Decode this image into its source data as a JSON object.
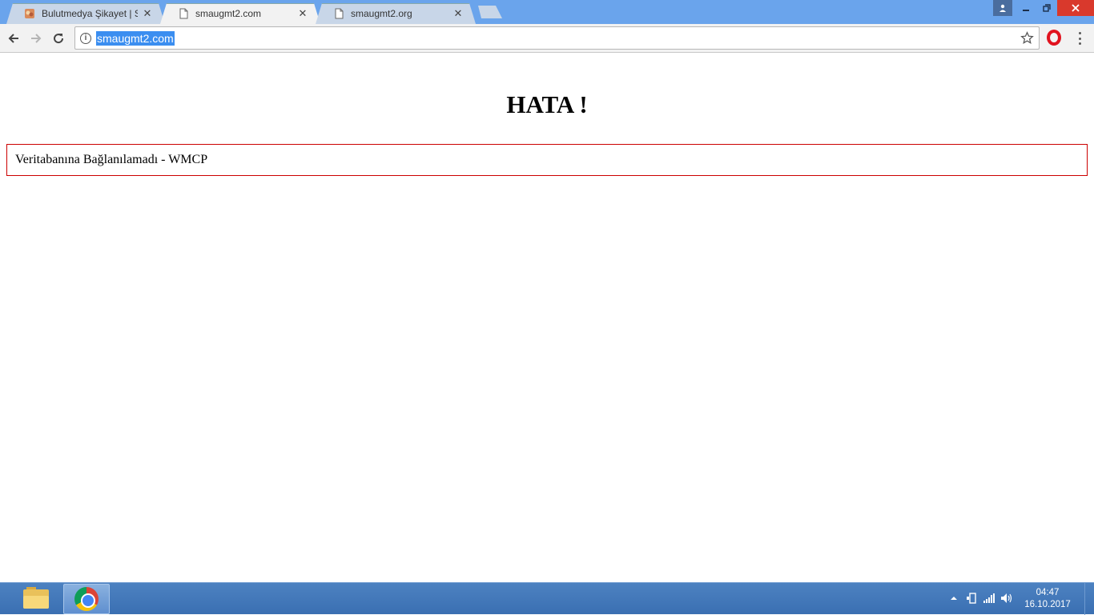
{
  "browser": {
    "tabs": [
      {
        "title": "Bulutmedya Şikayet | Say",
        "favicon": "bulutmedya-favicon",
        "active": false
      },
      {
        "title": "smaugmt2.com",
        "favicon": "page-icon",
        "active": true
      },
      {
        "title": "smaugmt2.org",
        "favicon": "page-icon",
        "active": false
      }
    ],
    "tab_close_glyph": "✕",
    "address": {
      "url": "smaugmt2.com"
    }
  },
  "page": {
    "title": "HATA !",
    "error_message": "Veritabanına Bağlanılamadı - WMCP"
  },
  "taskbar": {
    "clock": {
      "time": "04:47",
      "date": "16.10.2017"
    }
  },
  "colors": {
    "error_border": "#cc0000",
    "url_highlight": "#3b8ef0",
    "tabstrip": "#6aa4ec",
    "window_close": "#d9392c"
  }
}
